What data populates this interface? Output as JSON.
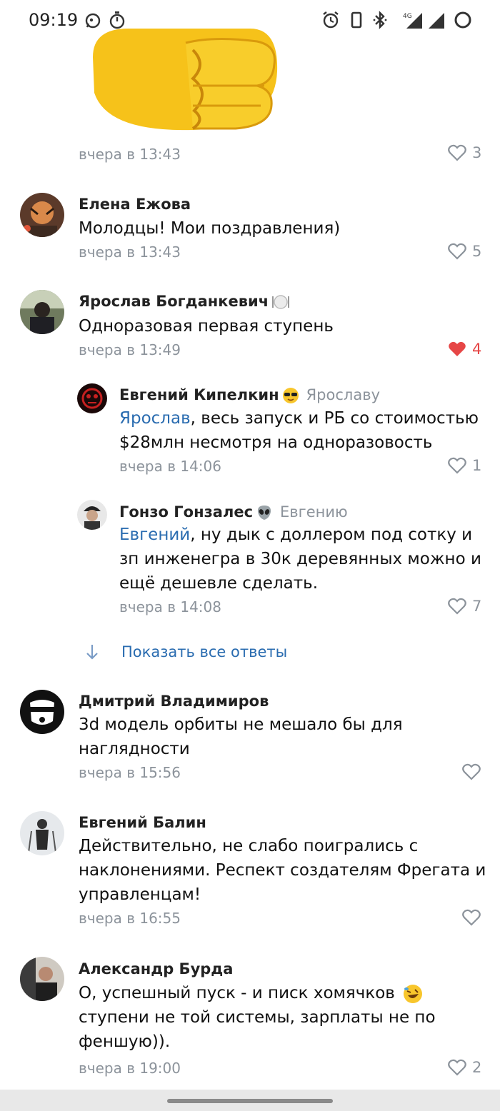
{
  "status_bar": {
    "time": "09:19",
    "icons": [
      "whatsapp-icon",
      "timer-icon",
      "alarm-icon",
      "vibrate-icon",
      "bluetooth-icon",
      "signal-4g-icon",
      "signal-icon",
      "battery-ring-icon"
    ]
  },
  "first_post": {
    "time": "вчера в 13:43",
    "likes": "3"
  },
  "comments": [
    {
      "author": "Елена Ежова",
      "lines": [
        "Молодцы! Мои поздравления)"
      ],
      "time": "вчера в 13:43",
      "likes": "5"
    },
    {
      "author": "Ярослав Богданкевич",
      "lines": [
        "Одноразовая первая ступень"
      ],
      "time": "вчера в 13:49",
      "likes": "4",
      "liked": true
    },
    {
      "author": "Евгений Кипелкин",
      "reply_to": "Ярославу",
      "mention": "Ярослав",
      "lines": [
        ", весь запуск и РБ со стоимостью",
        "$28млн несмотря на одноразовость"
      ],
      "time": "вчера в 14:06",
      "likes": "1"
    },
    {
      "author": "Гонзо Гонзалес",
      "reply_to": "Евгению",
      "mention": "Евгений",
      "lines": [
        ", ну дык с доллером под сотку и",
        "зп инженегра в 30к деревянных можно и",
        "ещё дешевле сделать."
      ],
      "time": "вчера в 14:08",
      "likes": "7"
    },
    {
      "author": "Дмитрий Владимиров",
      "lines": [
        "3d модель орбиты не мешало бы для",
        "наглядности"
      ],
      "time": "вчера в 15:56",
      "likes": ""
    },
    {
      "author": "Евгений Балин",
      "lines": [
        "Действительно, не слабо поигрались с",
        "наклонениями. Респект создателям Фрегата и",
        "управленцам!"
      ],
      "time": "вчера в 16:55",
      "likes": ""
    },
    {
      "author": "Александр Бурда",
      "lines": [
        "О, успешный пуск - и писк хомячков",
        "ступени не той системы, зарплаты не по",
        "феншую))."
      ],
      "time": "вчера в 19:00",
      "likes": "2"
    }
  ],
  "show_all_replies": "Показать все ответы",
  "colors": {
    "accent": "#2a6cb0",
    "muted": "#8c939b",
    "liked": "#e64646"
  }
}
